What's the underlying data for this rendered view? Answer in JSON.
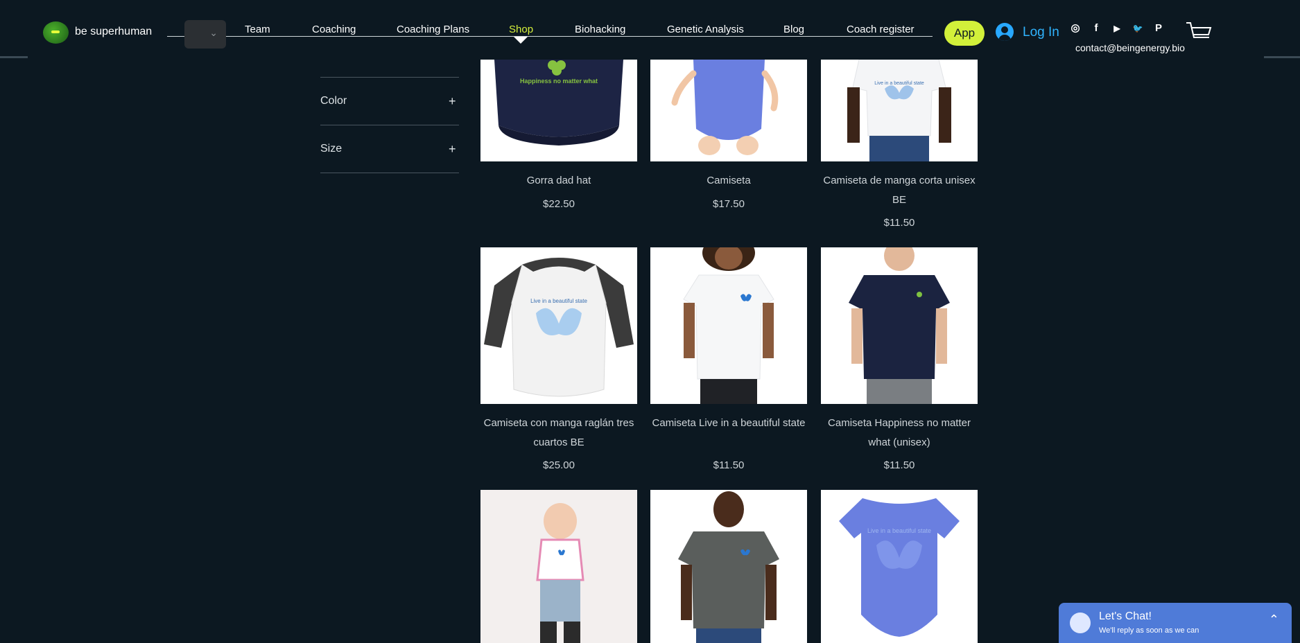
{
  "header": {
    "brand": "be superhuman",
    "nav": [
      {
        "label": "Team",
        "active": false
      },
      {
        "label": "Coaching",
        "active": false
      },
      {
        "label": "Coaching Plans",
        "active": false
      },
      {
        "label": "Shop",
        "active": true
      },
      {
        "label": "Biohacking",
        "active": false
      },
      {
        "label": "Genetic Analysis",
        "active": false
      },
      {
        "label": "Blog",
        "active": false
      },
      {
        "label": "Coach register",
        "active": false
      }
    ],
    "app_button": "App",
    "login_label": "Log In",
    "social": [
      {
        "icon": "instagram-icon",
        "glyph": "◎"
      },
      {
        "icon": "facebook-icon",
        "glyph": "f"
      },
      {
        "icon": "youtube-icon",
        "glyph": "▶"
      },
      {
        "icon": "twitter-icon",
        "glyph": "🐦"
      },
      {
        "icon": "pinterest-icon",
        "glyph": "P"
      }
    ],
    "email": "contact@beingenergy.bio",
    "accent_color": "#d5ef3b",
    "login_color": "#30b4ff"
  },
  "filters": [
    {
      "label": "Color",
      "toggle": "+"
    },
    {
      "label": "Size",
      "toggle": "+"
    }
  ],
  "products": [
    {
      "name": "Gorra dad hat",
      "price": "$22.50",
      "image": "cap-image",
      "print": "Happiness no matter what"
    },
    {
      "name": "Camiseta",
      "price": "$17.50",
      "image": "baby-bodysuit-image",
      "print": ""
    },
    {
      "name": "Camiseta de manga corta unisex BE",
      "price": "$11.50",
      "image": "tshirt-man-image",
      "print": "Live in a beautiful state"
    },
    {
      "name": "Camiseta con manga raglán tres cuartos BE",
      "price": "$25.00",
      "image": "raglan-shirt-image",
      "print": "Live in a beautiful state"
    },
    {
      "name": "Camiseta Live in a beautiful state",
      "price": "$11.50",
      "image": "tshirt-woman-image",
      "print": ""
    },
    {
      "name": "Camiseta Happiness no matter what (unisex)",
      "price": "$11.50",
      "image": "navy-tshirt-image",
      "print": ""
    },
    {
      "name": "",
      "price": "",
      "image": "toddler-bib-image",
      "print": ""
    },
    {
      "name": "",
      "price": "",
      "image": "grey-tshirt-image",
      "print": ""
    },
    {
      "name": "",
      "price": "",
      "image": "baby-onesie-image",
      "print": "Live in a beautiful state"
    }
  ],
  "chat": {
    "title": "Let's Chat!",
    "subtitle": "We'll reply as soon as we can"
  }
}
